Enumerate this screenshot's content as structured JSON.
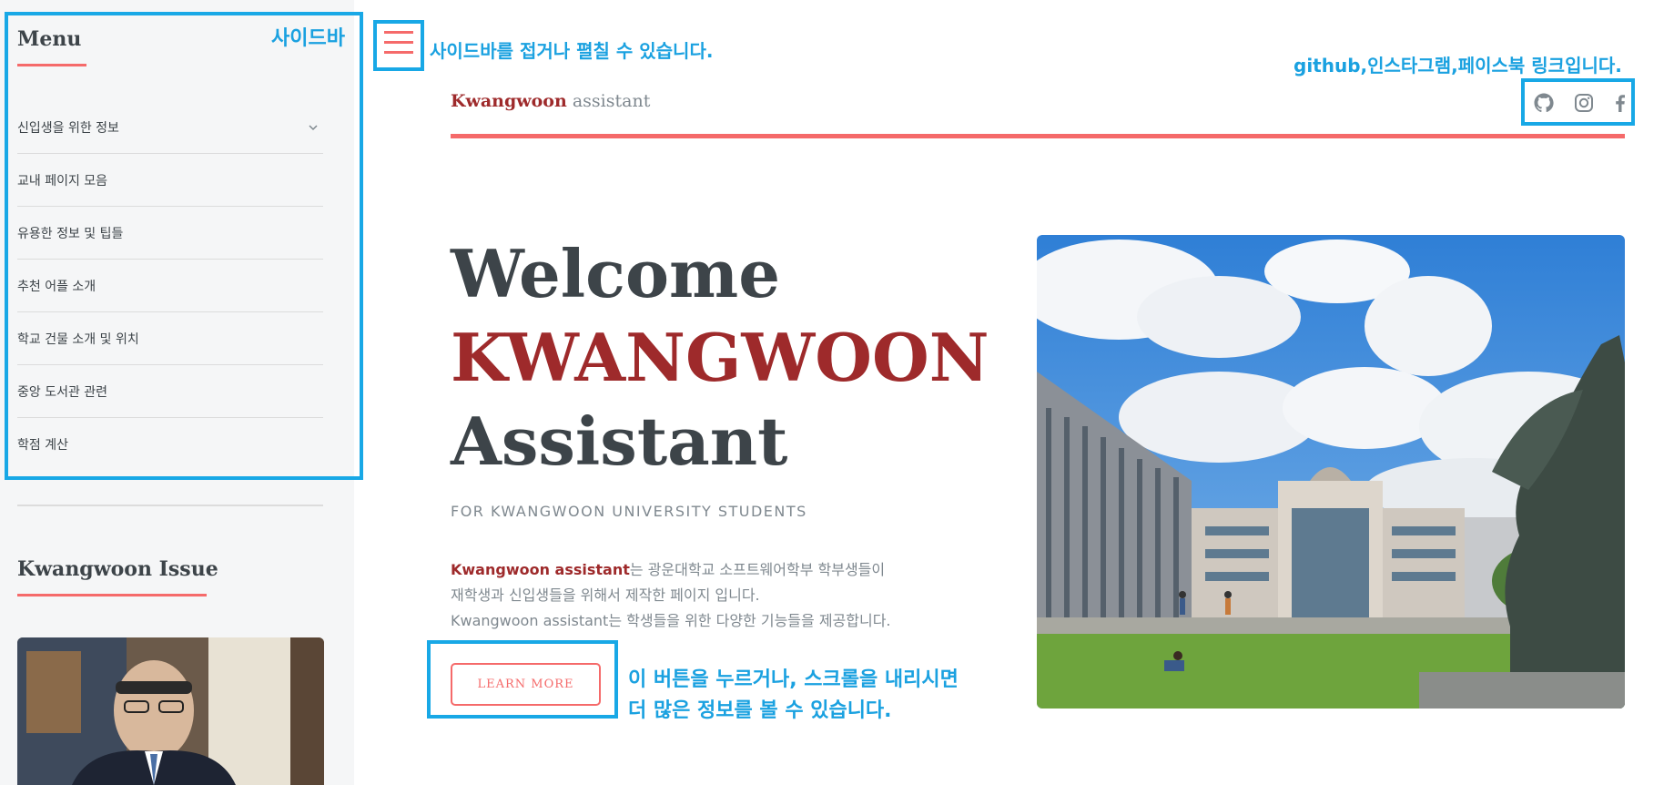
{
  "sidebar": {
    "menu_heading": "Menu",
    "items": [
      {
        "label": "신입생을 위한 정보",
        "has_chevron": true
      },
      {
        "label": "교내 페이지 모음"
      },
      {
        "label": "유용한 정보 및 팁들"
      },
      {
        "label": "추천 어플 소개"
      },
      {
        "label": "학교 건물 소개 및 위치"
      },
      {
        "label": "중앙 도서관 관련"
      },
      {
        "label": "학점 계산"
      }
    ],
    "issue_heading": "Kwangwoon Issue"
  },
  "header": {
    "logo_brand": "Kwangwoon",
    "logo_rest": "assistant",
    "social_icons": [
      "github-icon",
      "instagram-icon",
      "facebook-icon"
    ]
  },
  "hero": {
    "title_line1": "Welcome",
    "title_line2": "KWANGWOON",
    "title_line3": "Assistant",
    "subtitle": "FOR KWANGWOON UNIVERSITY STUDENTS",
    "desc_strong": "Kwangwoon assistant",
    "desc_line1_rest": "는 광운대학교 소프트웨어학부 학부생들이",
    "desc_line2": "재학생과 신입생들을 위해서 제작한 페이지 입니다.",
    "desc_line3": "Kwangwoon assistant는 학생들을 위한 다양한 기능들을 제공합니다.",
    "button_label": "LEARN MORE"
  },
  "annotations": {
    "sidebar": "사이드바",
    "toggle": "사이드바를 접거나 펼칠 수 있습니다.",
    "social": "github,인스타그램,페이스북 링크입니다.",
    "learn_line1": "이 버튼을 누르거나, 스크롤을 내리시면",
    "learn_line2": "더 많은 정보를 볼 수 있습니다."
  },
  "colors": {
    "accent": "#f56a6a",
    "brand": "#9e2a2b",
    "annotation": "#18a8e6",
    "sidebar_bg": "#f5f6f7",
    "text": "#3d4449"
  }
}
